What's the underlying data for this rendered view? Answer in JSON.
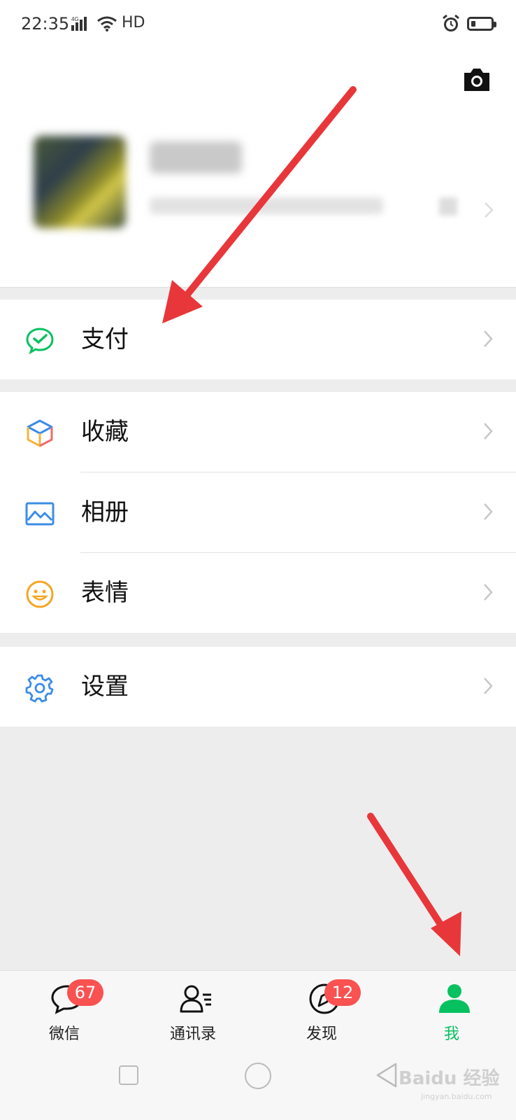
{
  "status_bar": {
    "time": "22:35",
    "network": "4G",
    "hd": "HD"
  },
  "profile": {
    "name": "",
    "wechat_id": ""
  },
  "menu_groups": [
    [
      {
        "key": "pay",
        "label": "支付",
        "icon": "wechat-pay-icon"
      }
    ],
    [
      {
        "key": "favorites",
        "label": "收藏",
        "icon": "favorites-cube-icon"
      },
      {
        "key": "album",
        "label": "相册",
        "icon": "album-image-icon"
      },
      {
        "key": "stickers",
        "label": "表情",
        "icon": "smiley-icon"
      }
    ],
    [
      {
        "key": "settings",
        "label": "设置",
        "icon": "gear-icon"
      }
    ]
  ],
  "tabbar": {
    "tabs": [
      {
        "label": "微信",
        "icon": "chat-bubble-icon",
        "badge": "67"
      },
      {
        "label": "通讯录",
        "icon": "contacts-icon",
        "badge": ""
      },
      {
        "label": "发现",
        "icon": "compass-icon",
        "badge": "12"
      },
      {
        "label": "我",
        "icon": "person-icon",
        "badge": "",
        "active": true
      }
    ]
  },
  "watermark": {
    "text": "Baidu 经验",
    "sub": "jingyan.baidu.com"
  },
  "colors": {
    "accent_green": "#07c160",
    "badge_red": "#fa5151",
    "annotation_red": "#e8373a"
  }
}
